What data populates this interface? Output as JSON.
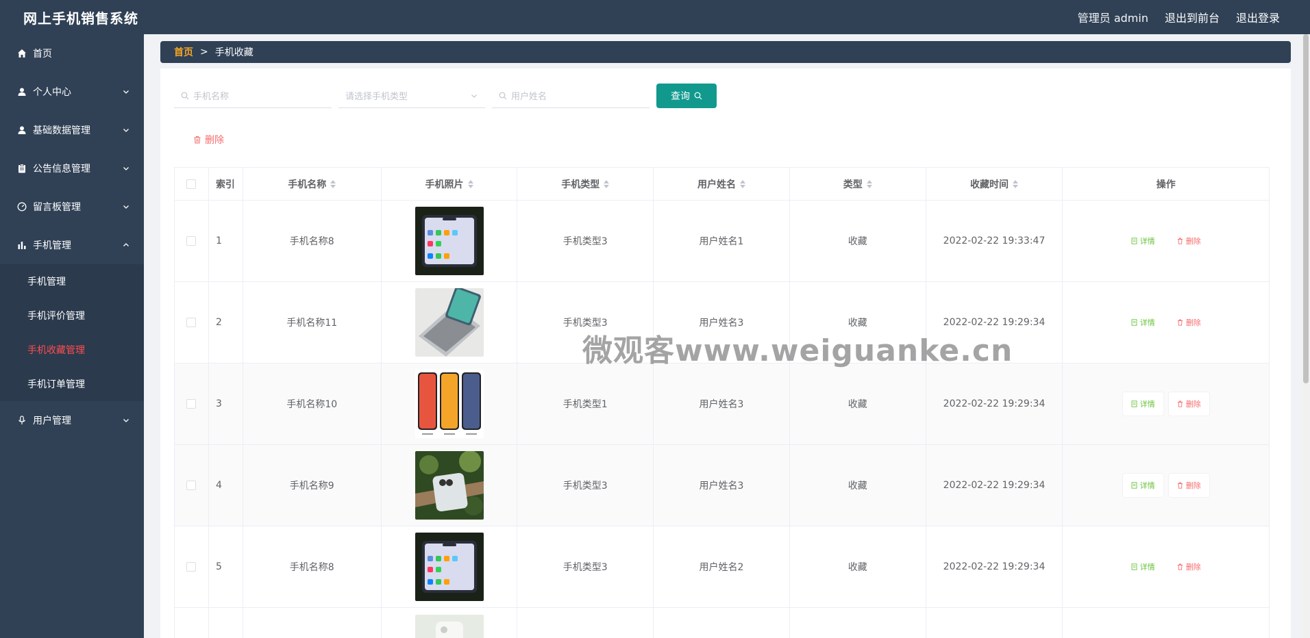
{
  "app": {
    "title": "网上手机销售系统"
  },
  "header": {
    "admin": "管理员 admin",
    "to_front": "退出到前台",
    "logout": "退出登录"
  },
  "sidebar": {
    "items": [
      {
        "label": "首页",
        "icon": "home-icon"
      },
      {
        "label": "个人中心",
        "icon": "user-icon"
      },
      {
        "label": "基础数据管理",
        "icon": "user-icon"
      },
      {
        "label": "公告信息管理",
        "icon": "clipboard-icon"
      },
      {
        "label": "留言板管理",
        "icon": "gauge-icon"
      },
      {
        "label": "手机管理",
        "icon": "bar-chart-icon"
      },
      {
        "label": "用户管理",
        "icon": "microphone-icon"
      }
    ],
    "sub": [
      "手机管理",
      "手机评价管理",
      "手机收藏管理",
      "手机订单管理"
    ]
  },
  "breadcrumb": {
    "home": "首页",
    "sep": ">",
    "current": "手机收藏"
  },
  "search": {
    "phone_name_placeholder": "手机名称",
    "phone_type_placeholder": "请选择手机类型",
    "user_name_placeholder": "用户姓名",
    "query_label": "查询"
  },
  "toolbar": {
    "delete_label": "删除"
  },
  "table": {
    "headers": [
      "索引",
      "手机名称",
      "手机照片",
      "手机类型",
      "用户姓名",
      "类型",
      "收藏时间",
      "操作"
    ],
    "rows": [
      {
        "index": "1",
        "name": "手机名称8",
        "type": "手机类型3",
        "user": "用户姓名1",
        "kind": "收藏",
        "time": "2022-02-22 19:33:47"
      },
      {
        "index": "2",
        "name": "手机名称11",
        "type": "手机类型3",
        "user": "用户姓名3",
        "kind": "收藏",
        "time": "2022-02-22 19:29:34"
      },
      {
        "index": "3",
        "name": "手机名称10",
        "type": "手机类型1",
        "user": "用户姓名3",
        "kind": "收藏",
        "time": "2022-02-22 19:29:34"
      },
      {
        "index": "4",
        "name": "手机名称9",
        "type": "手机类型3",
        "user": "用户姓名3",
        "kind": "收藏",
        "time": "2022-02-22 19:29:34"
      },
      {
        "index": "5",
        "name": "手机名称8",
        "type": "手机类型3",
        "user": "用户姓名2",
        "kind": "收藏",
        "time": "2022-02-22 19:29:34"
      }
    ],
    "detail_label": "详情",
    "delete_label": "删除"
  },
  "watermark": "微观客www.weiguanke.cn",
  "colors": {
    "header_bg": "#304156",
    "accent": "#11998e",
    "danger": "#f56c6c",
    "success": "#67c23a",
    "active_menu": "#ff4d4f"
  }
}
